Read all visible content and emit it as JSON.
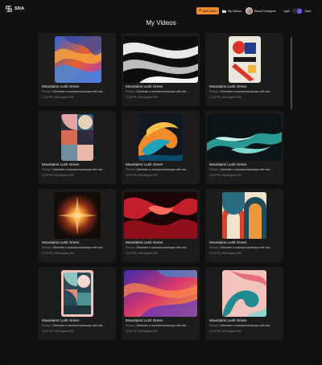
{
  "header": {
    "logo_text": "SRA",
    "new_video_label": "New Video",
    "my_videos_label": "My Videos",
    "user_name": "Elena Rodriguez",
    "theme_light": "Light",
    "theme_dark": "Dark"
  },
  "page_title": "My Videos",
  "colors": {
    "accent": "#f28a2e",
    "toggle": "#6a5cf0",
    "background": "#101010",
    "card": "#1c1c1c"
  },
  "videos": [
    {
      "title": "Mountains Lush Green",
      "prompt_label": "Prompt |",
      "prompt": "Generate a mountain landscape with lust...",
      "date": "12:26 PM, 26th August 2024",
      "art": "fluid-orange-blue"
    },
    {
      "title": "Mountains Lush Green",
      "prompt_label": "Prompt |",
      "prompt": "Generate a mountain landscape with lust...",
      "date": "12:26 PM, 26th August 2024",
      "art": "black-white-waves"
    },
    {
      "title": "Mountains Lush Green",
      "prompt_label": "Prompt |",
      "prompt": "Generate a mountain landscape with lust...",
      "date": "12:26 PM, 26th August 2024",
      "art": "bauhaus-poster"
    },
    {
      "title": "Mountains Lush Green",
      "prompt_label": "Prompt |",
      "prompt": "Generate a mountain landscape with lust...",
      "date": "12:26 PM, 26th August 2024",
      "art": "geometric-pastel"
    },
    {
      "title": "Mountains Lush Green",
      "prompt_label": "Prompt |",
      "prompt": "Generate a mountain landscape with lust...",
      "date": "12:26 PM, 26th August 2024",
      "art": "wave-orange-teal"
    },
    {
      "title": "Mountains Lush Green",
      "prompt_label": "Prompt |",
      "prompt": "Generate a mountain landscape with lust...",
      "date": "12:26 PM, 26th August 2024",
      "art": "teal-splash"
    },
    {
      "title": "Mountains Lush Green",
      "prompt_label": "Prompt |",
      "prompt": "Generate a mountain landscape with lust...",
      "date": "12:26 PM, 26th August 2024",
      "art": "explosion"
    },
    {
      "title": "Mountains Lush Green",
      "prompt_label": "Prompt |",
      "prompt": "Generate a mountain landscape with lust...",
      "date": "12:26 PM, 26th August 2024",
      "art": "red-swirls"
    },
    {
      "title": "Mountains Lush Green",
      "prompt_label": "Prompt |",
      "prompt": "Generate a mountain landscape with lust...",
      "date": "12:26 PM, 26th August 2024",
      "art": "retro-arches"
    },
    {
      "title": "Mountains Lush Green",
      "prompt_label": "Prompt |",
      "prompt": "Generate a mountain landscape with lust...",
      "date": "12:26 PM, 26th August 2024",
      "art": "pastel-tiles"
    },
    {
      "title": "Mountains Lush Green",
      "prompt_label": "Prompt |",
      "prompt": "Generate a mountain landscape with lust...",
      "date": "12:26 PM, 26th August 2024",
      "art": "nebula-fluid"
    },
    {
      "title": "Mountains Lush Green",
      "prompt_label": "Prompt |",
      "prompt": "Generate a mountain landscape with lust...",
      "date": "12:26 PM, 26th August 2024",
      "art": "teal-pink-swirl"
    }
  ]
}
